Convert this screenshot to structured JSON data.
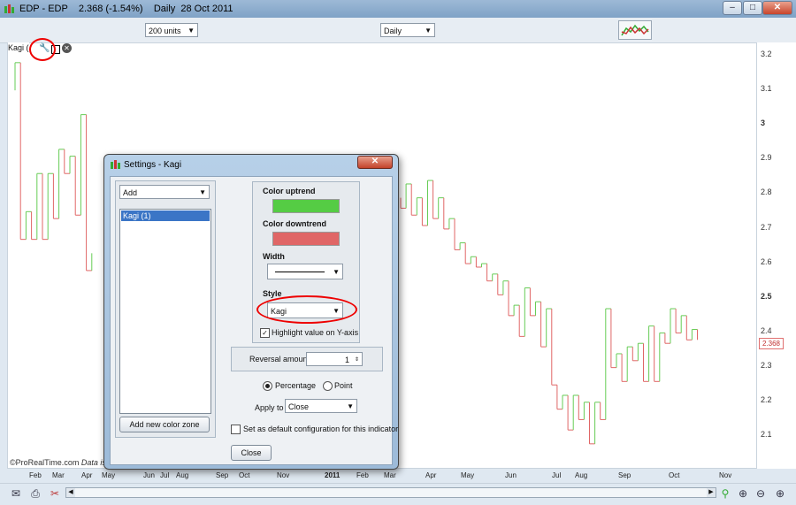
{
  "window": {
    "title": "EDP - EDP    2.368 (-1.54%)    Daily  28 Oct 2011",
    "minimize": "–",
    "maximize": "□",
    "close": "✕"
  },
  "toolbar": {
    "units_value": "200 units",
    "period_value": "Daily"
  },
  "chart": {
    "indicator_label": "Kagi (",
    "watermark_brand": "©ProRealTime.com",
    "watermark_text": "Data is e",
    "last_price": "2.368",
    "y_ticks": [
      "3.2",
      "3.1",
      "3",
      "2.9",
      "2.8",
      "2.7",
      "2.6",
      "2.5",
      "2.4",
      "2.3",
      "2.2",
      "2.1"
    ],
    "x_ticks": [
      "Feb",
      "Mar",
      "Apr",
      "May",
      "Jun",
      "Jul",
      "Aug",
      "Sep",
      "Oct",
      "Nov",
      "2011",
      "Feb",
      "Mar",
      "Apr",
      "May",
      "Jun",
      "Jul",
      "Aug",
      "Sep",
      "Oct",
      "Nov"
    ],
    "colors": {
      "uptrend": "#66cc55",
      "downtrend": "#e06666"
    }
  },
  "chart_data": {
    "type": "line",
    "subtype": "kagi",
    "y_range": [
      2.04,
      3.25
    ],
    "segments_up_color": "#66cc55",
    "segments_down_color": "#e06666",
    "kagi_points": [
      3.1,
      3.18,
      2.67,
      2.75,
      2.67,
      2.86,
      2.67,
      2.86,
      2.73,
      2.93,
      2.86,
      2.91,
      2.74,
      3.03,
      2.58,
      2.63
    ],
    "kagi_points_right": [
      2.79,
      2.76,
      2.83,
      2.74,
      2.79,
      2.71,
      2.84,
      2.73,
      2.79,
      2.7,
      2.73,
      2.64,
      2.66,
      2.6,
      2.62,
      2.59,
      2.6,
      2.55,
      2.57,
      2.51,
      2.55,
      2.45,
      2.48,
      2.39,
      2.53,
      2.45,
      2.49,
      2.36,
      2.47,
      2.25,
      2.18,
      2.22,
      2.12,
      2.22,
      2.15,
      2.2,
      2.08,
      2.2,
      2.15,
      2.47,
      2.3,
      2.34,
      2.26,
      2.36,
      2.32,
      2.37,
      2.26,
      2.42,
      2.26,
      2.4,
      2.37,
      2.47,
      2.4,
      2.45,
      2.38,
      2.41,
      2.38
    ]
  },
  "dialog": {
    "title": "Settings - Kagi",
    "add_value": "Add",
    "list_items": [
      "Kagi (1)"
    ],
    "add_zone_button": "Add new color zone",
    "color_uptrend_label": "Color uptrend",
    "color_downtrend_label": "Color downtrend",
    "width_label": "Width",
    "style_label": "Style",
    "style_value": "Kagi",
    "highlight_label": "Highlight value on Y-axis",
    "reversal_label": "Reversal amount",
    "reversal_value": "1",
    "percentage_label": "Percentage",
    "point_label": "Point",
    "apply_to_label": "Apply to",
    "apply_to_value": "Close",
    "default_config_label": "Set as default configuration for this indicator",
    "close_button": "Close"
  }
}
